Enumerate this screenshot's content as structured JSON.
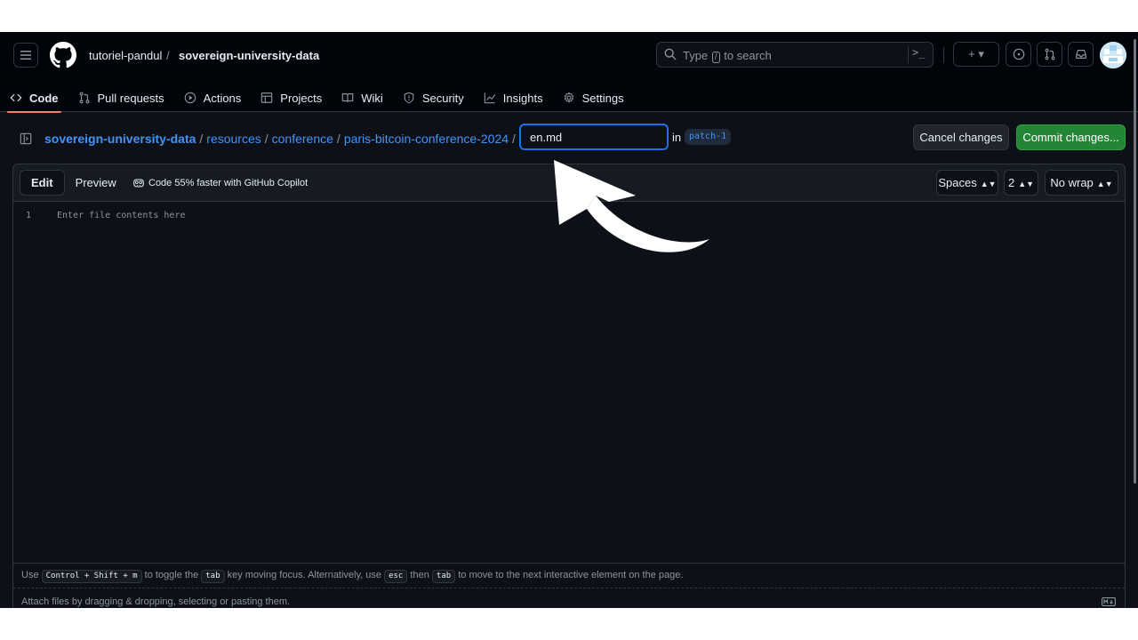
{
  "header": {
    "repo_owner": "tutoriel-pandul",
    "repo_separator": "/",
    "repo_name": "sovereign-university-data",
    "search": {
      "prefix": "Type",
      "key": "/",
      "suffix": "to search"
    },
    "command_palette": ">_",
    "create_button": "+ ▾"
  },
  "nav": [
    {
      "label": "Code",
      "icon": "code-icon",
      "active": true
    },
    {
      "label": "Pull requests",
      "icon": "pull-request-icon"
    },
    {
      "label": "Actions",
      "icon": "play-icon"
    },
    {
      "label": "Projects",
      "icon": "table-icon"
    },
    {
      "label": "Wiki",
      "icon": "book-icon"
    },
    {
      "label": "Security",
      "icon": "shield-icon"
    },
    {
      "label": "Insights",
      "icon": "graph-icon"
    },
    {
      "label": "Settings",
      "icon": "gear-icon"
    }
  ],
  "file": {
    "breadcrumb": [
      "sovereign-university-data",
      "resources",
      "conference",
      "paris-bitcoin-conference-2024"
    ],
    "separator": "/",
    "filename": "en.md",
    "in_label": "in",
    "branch": "patch-1",
    "cancel_label": "Cancel changes",
    "commit_label": "Commit changes..."
  },
  "editor": {
    "tabs": [
      "Edit",
      "Preview"
    ],
    "copilot_promo": "Code 55% faster with GitHub Copilot",
    "indent_mode": "Spaces",
    "indent_size": "2",
    "wrap_mode": "No wrap",
    "line_number": "1",
    "placeholder": "Enter file contents here",
    "help": {
      "use": "Use",
      "shortcut": "Control + Shift + m",
      "to_toggle_the": "to toggle the",
      "tab_key": "tab",
      "key_moving_focus": "key moving focus. Alternatively, use",
      "esc_key": "esc",
      "then": "then",
      "tab_key_2": "tab",
      "to_move": "to move to the next interactive element on the page."
    },
    "attach_text": "Attach files by dragging & dropping, selecting or pasting them."
  },
  "colors": {
    "background": "#0d1117",
    "header": "#010409",
    "link": "#4493f8",
    "commit_green": "#238636",
    "active_tab_underline": "#f78166"
  }
}
